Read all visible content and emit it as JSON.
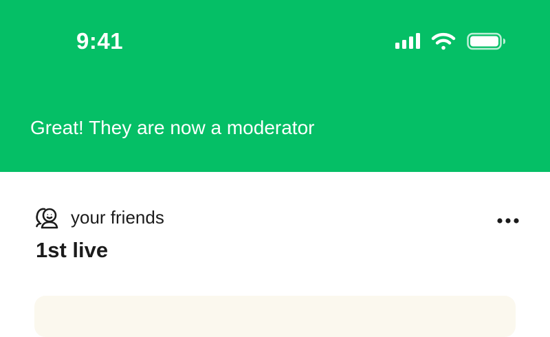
{
  "status_bar": {
    "time": "9:41",
    "icons": [
      "cellular-signal-icon",
      "wifi-icon",
      "battery-icon"
    ]
  },
  "banner": {
    "message": "Great! They are now a moderator",
    "color": "#05BF66"
  },
  "stream": {
    "audience_label": "your friends",
    "audience_icon": "friends-icon",
    "title": "1st live",
    "more_icon": "more-horizontal-icon"
  }
}
